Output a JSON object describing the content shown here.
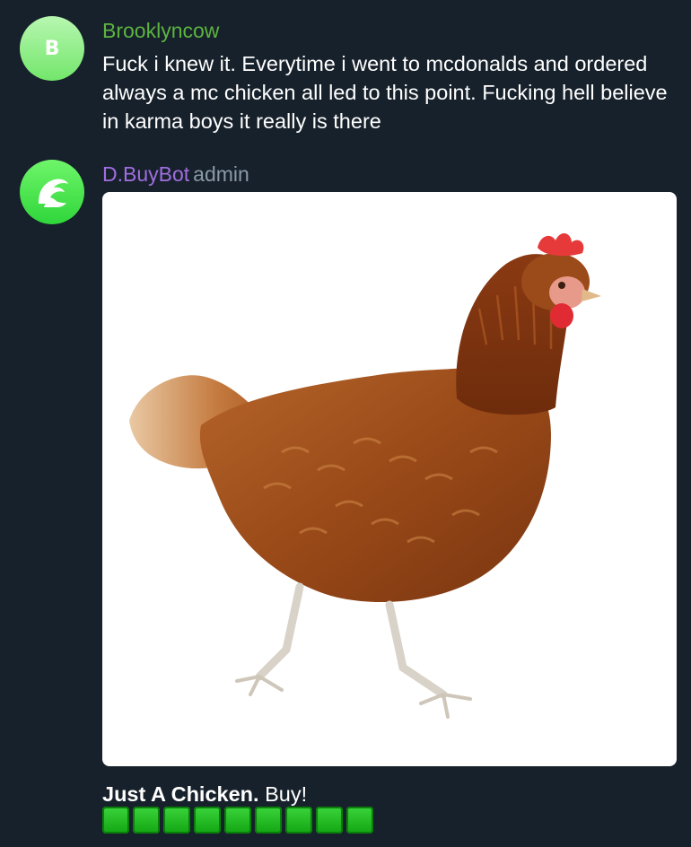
{
  "messages": [
    {
      "avatar_letter": "B",
      "sender": "Brooklyncow",
      "text": "Fuck i knew it. Everytime i went to mcdonalds and ordered always a mc chicken all led to this point. Fucking hell believe in karma boys it really is there"
    },
    {
      "sender": "D.BuyBot",
      "role": "admin",
      "avatar_icon": "wave-icon",
      "photo_subject": "chicken-photo",
      "caption_bold": "Just A Chicken.",
      "caption_rest": " Buy!",
      "squares": [
        "🟩",
        "🟩",
        "🟩",
        "🟩",
        "🟩",
        "🟩",
        "🟩",
        "🟩",
        "🟩"
      ]
    }
  ],
  "colors": {
    "background": "#17212b",
    "sender_green": "#5cb43f",
    "sender_purple": "#a06ee0",
    "role_gray": "#8b9aa8",
    "square_green": "#1db31d"
  }
}
